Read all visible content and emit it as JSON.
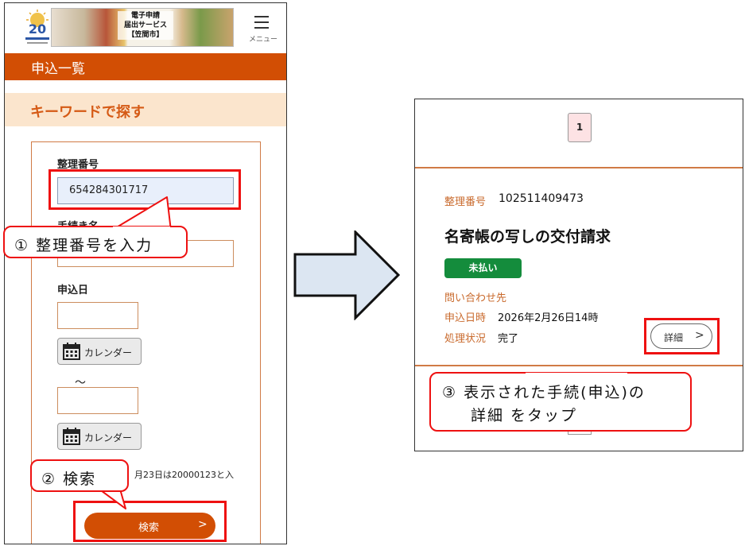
{
  "phone": {
    "banner_text": "電子申請\n届出サービス\n【笠間市】",
    "logo_text": "20",
    "menu_label": "メニュー",
    "page_title": "申込一覧",
    "keyword_title": "キーワードで探す",
    "form": {
      "ref_label": "整理番号",
      "ref_value": "654284301717",
      "proc_name_label": "手続き名",
      "proc_name_value": "",
      "date_label": "申込日",
      "date_from_value": "",
      "date_to_value": "",
      "calendar_label": "カレンダー",
      "tilde": "～",
      "hint": "月23日は20000123と入",
      "search_label": "検索",
      "search_arrow": ">"
    }
  },
  "callouts": {
    "step1": "① 整理番号を入力",
    "step2": "② 検索",
    "step3_line1": "③ 表示された手続(申込)の",
    "step3_line2": "詳細 をタップ"
  },
  "detail": {
    "page_number": "1",
    "ref_label": "整理番号",
    "ref_value": "102511409473",
    "proc_title": "名寄帳の写しの交付請求",
    "status_badge": "未払い",
    "contact_link": "問い合わせ先",
    "applied_label": "申込日時",
    "applied_value": "2026年2月26日14時",
    "state_label": "処理状況",
    "state_value": "完了",
    "detail_button": "詳細",
    "detail_arrow": ">"
  },
  "colors": {
    "accent": "#d24e04",
    "keyword_bg": "#fbe5cd",
    "highlight": "#ee1111",
    "badge_green": "#148c3c",
    "arrow_fill": "#dce6f2"
  },
  "icons": [
    "menu-icon",
    "calendar-icon",
    "arrow-right-icon",
    "chevron-right-icon"
  ]
}
